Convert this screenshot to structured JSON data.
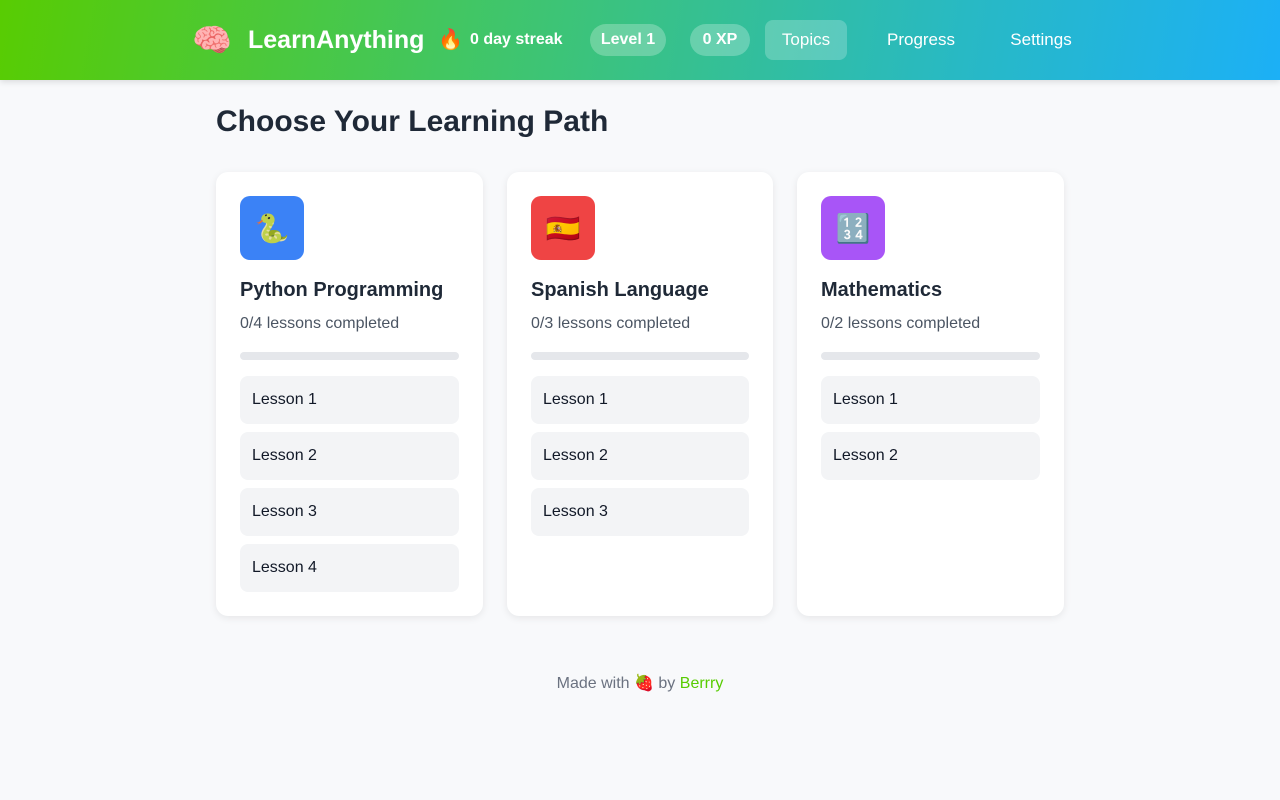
{
  "header": {
    "logo_icon": "🧠",
    "logo_text": "LearnAnything",
    "streak_icon": "🔥",
    "streak_text": "0 day streak",
    "level": "Level 1",
    "xp": "0 XP",
    "nav": {
      "topics": "Topics",
      "progress": "Progress",
      "settings": "Settings"
    }
  },
  "main": {
    "title": "Choose Your Learning Path",
    "topics": [
      {
        "icon": "🐍",
        "icon_color": "#3b82f6",
        "title": "Python Programming",
        "progress_text": "0/4 lessons completed",
        "progress_fraction": 0,
        "lessons": [
          "Lesson 1",
          "Lesson 2",
          "Lesson 3",
          "Lesson 4"
        ]
      },
      {
        "icon": "🇪🇸",
        "icon_color": "#ef4444",
        "title": "Spanish Language",
        "progress_text": "0/3 lessons completed",
        "progress_fraction": 0,
        "lessons": [
          "Lesson 1",
          "Lesson 2",
          "Lesson 3"
        ]
      },
      {
        "icon": "🔢",
        "icon_color": "#a855f7",
        "title": "Mathematics",
        "progress_text": "0/2 lessons completed",
        "progress_fraction": 0,
        "lessons": [
          "Lesson 1",
          "Lesson 2"
        ]
      }
    ]
  },
  "footer": {
    "prefix": "Made with",
    "icon": "🍓",
    "by": "by",
    "link": "Berrry"
  },
  "colors": {
    "accent": "#58cc02",
    "progress_track": "#e5e7eb"
  }
}
